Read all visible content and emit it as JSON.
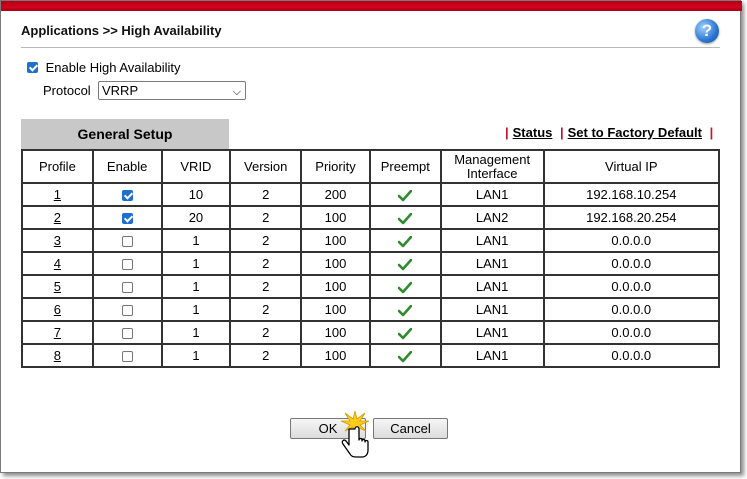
{
  "header": {
    "title": "Applications >> High Availability",
    "help_icon": "?"
  },
  "settings": {
    "enable_label": "Enable High Availability",
    "enabled": true,
    "protocol_label": "Protocol",
    "protocol_value": "VRRP"
  },
  "tabs": {
    "general_setup": "General Setup"
  },
  "links": {
    "status": "Status",
    "factory_default": "Set to Factory Default",
    "separator": "|"
  },
  "table": {
    "columns": [
      "Profile",
      "Enable",
      "VRID",
      "Version",
      "Priority",
      "Preempt",
      "Management Interface",
      "Virtual IP"
    ],
    "rows": [
      {
        "profile": "1",
        "enabled": true,
        "vrid": "10",
        "version": "2",
        "priority": "200",
        "preempt": true,
        "interface": "LAN1",
        "virtual_ip": "192.168.10.254"
      },
      {
        "profile": "2",
        "enabled": true,
        "vrid": "20",
        "version": "2",
        "priority": "100",
        "preempt": true,
        "interface": "LAN2",
        "virtual_ip": "192.168.20.254"
      },
      {
        "profile": "3",
        "enabled": false,
        "vrid": "1",
        "version": "2",
        "priority": "100",
        "preempt": true,
        "interface": "LAN1",
        "virtual_ip": "0.0.0.0"
      },
      {
        "profile": "4",
        "enabled": false,
        "vrid": "1",
        "version": "2",
        "priority": "100",
        "preempt": true,
        "interface": "LAN1",
        "virtual_ip": "0.0.0.0"
      },
      {
        "profile": "5",
        "enabled": false,
        "vrid": "1",
        "version": "2",
        "priority": "100",
        "preempt": true,
        "interface": "LAN1",
        "virtual_ip": "0.0.0.0"
      },
      {
        "profile": "6",
        "enabled": false,
        "vrid": "1",
        "version": "2",
        "priority": "100",
        "preempt": true,
        "interface": "LAN1",
        "virtual_ip": "0.0.0.0"
      },
      {
        "profile": "7",
        "enabled": false,
        "vrid": "1",
        "version": "2",
        "priority": "100",
        "preempt": true,
        "interface": "LAN1",
        "virtual_ip": "0.0.0.0"
      },
      {
        "profile": "8",
        "enabled": false,
        "vrid": "1",
        "version": "2",
        "priority": "100",
        "preempt": true,
        "interface": "LAN1",
        "virtual_ip": "0.0.0.0"
      }
    ]
  },
  "buttons": {
    "ok": "OK",
    "cancel": "Cancel"
  },
  "colors": {
    "accent_red": "#c8102e",
    "checkbox_blue": "#1f6fcf",
    "check_green": "#2e8b2e"
  }
}
